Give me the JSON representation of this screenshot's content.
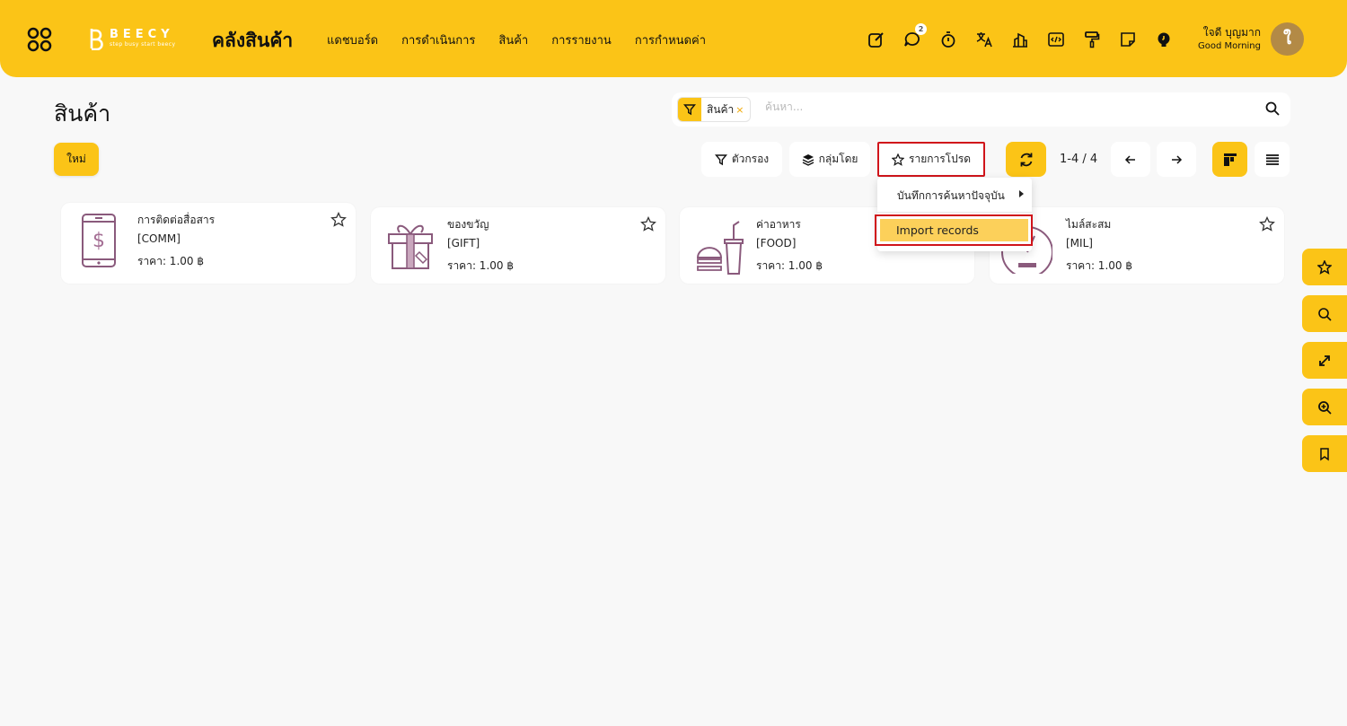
{
  "brand": {
    "name": "BEECY",
    "tagline": "step busy start beecy"
  },
  "app": {
    "title": "คลังสินค้า"
  },
  "menu": [
    {
      "label": "แดชบอร์ด"
    },
    {
      "label": "การดำเนินการ"
    },
    {
      "label": "สินค้า"
    },
    {
      "label": "การรายงาน"
    },
    {
      "label": "การกำหนดค่า"
    }
  ],
  "tools": {
    "chat_badge": "2"
  },
  "user": {
    "name": "ใจดี บุญมาก",
    "greeting": "Good Morning",
    "avatar_letter": "ใ"
  },
  "page": {
    "title": "สินค้า"
  },
  "search": {
    "facet_label": "สินค้า",
    "facet_remove": "×",
    "placeholder": "ค้นหา..."
  },
  "controls": {
    "new_label": "ใหม่",
    "filter_label": "ตัวกรอง",
    "group_label": "กลุ่มโดย",
    "favorites_label": "รายการโปรด",
    "pager": "1-4 / 4"
  },
  "dropdown": {
    "save_search": "บันทึกการค้นหาปัจจุบัน",
    "import_records": "Import records"
  },
  "cards": [
    {
      "name": "การติดต่อสื่อสาร",
      "code": "[COMM]",
      "price": "ราคา: 1.00 ฿",
      "icon": "phone-dollar-icon"
    },
    {
      "name": "ของขวัญ",
      "code": "[GIFT]",
      "price": "ราคา: 1.00 ฿",
      "icon": "gift-icon"
    },
    {
      "name": "ค่าอาหาร",
      "code": "[FOOD]",
      "price": "ราคา: 1.00 ฿",
      "icon": "food-icon"
    },
    {
      "name": "ไมล์สะสม",
      "code": "[MIL]",
      "price": "ราคา: 1.00 ฿",
      "icon": "speedometer-icon"
    }
  ],
  "colors": {
    "accent": "#fbc417",
    "highlight": "#fcd05a",
    "outline_red": "#d0141a",
    "icon_purple": "#8a5a7c"
  }
}
